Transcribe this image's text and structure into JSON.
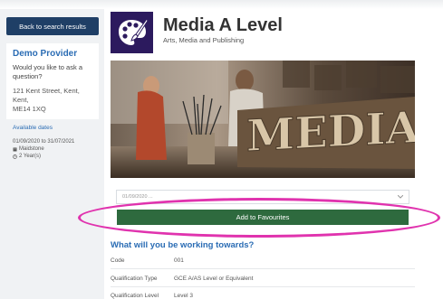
{
  "sidebar": {
    "back_button": "Back to search results",
    "provider": {
      "name": "Demo Provider",
      "ask_question": "Would you like to ask a question?",
      "address_line1": "121 Kent Street, Kent, Kent,",
      "address_line2": "ME14 1XQ"
    },
    "available_dates": {
      "title": "Available dates",
      "date_range": "01/09/2020 to 31/07/2021",
      "location": "Maidstone",
      "duration": "2 Year(s)"
    }
  },
  "course": {
    "title": "Media A Level",
    "subject": "Arts, Media and Publishing",
    "logo_icon": "palette-brush-icon",
    "hero_word": "MEDIA"
  },
  "actions": {
    "date_select_value": "01/09/2020 ...",
    "favourites_button": "Add to Favourites"
  },
  "working_towards": {
    "title": "What will you be working towards?",
    "rows": [
      {
        "key": "Code",
        "value": "001"
      },
      {
        "key": "Qualification Type",
        "value": "GCE A/AS Level or Equivalent"
      },
      {
        "key": "Qualification Level",
        "value": "Level 3"
      }
    ]
  },
  "colors": {
    "navy": "#1f3f66",
    "link_blue": "#2a6cb4",
    "green": "#2e6a3e",
    "highlight_magenta": "#e033ae",
    "logo_purple": "#2c1a5e"
  }
}
